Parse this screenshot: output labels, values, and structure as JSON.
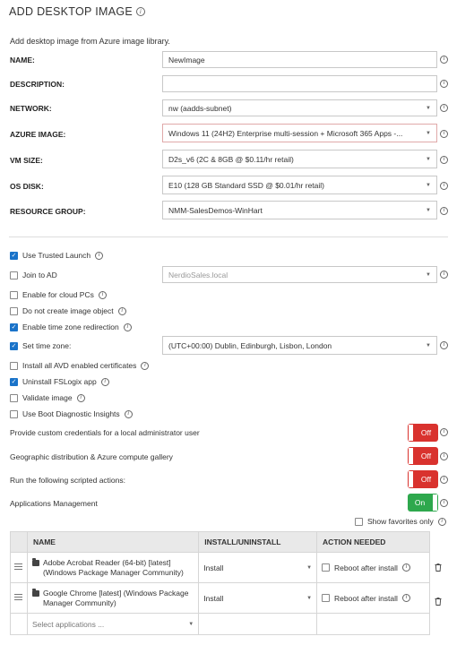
{
  "header": {
    "title": "ADD DESKTOP IMAGE",
    "subtitle": "Add desktop image from Azure image library."
  },
  "fields": [
    {
      "label": "NAME:",
      "value": "NewImage",
      "type": "text"
    },
    {
      "label": "DESCRIPTION:",
      "value": "",
      "type": "text"
    },
    {
      "label": "NETWORK:",
      "value": "nw (aadds-subnet)",
      "type": "select"
    },
    {
      "label": "AZURE IMAGE:",
      "value": "Windows 11 (24H2) Enterprise multi-session + Microsoft 365 Apps -...",
      "type": "select"
    },
    {
      "label": "VM SIZE:",
      "value": "D2s_v6 (2C & 8GB @ $0.11/hr retail)",
      "type": "select"
    },
    {
      "label": "OS DISK:",
      "value": "E10 (128 GB Standard SSD @ $0.01/hr retail)",
      "type": "select"
    },
    {
      "label": "RESOURCE GROUP:",
      "value": "NMM-SalesDemos-WinHart",
      "type": "select"
    }
  ],
  "options": [
    {
      "label": "Use Trusted Launch",
      "checked": true,
      "info": true
    },
    {
      "label": "Join to AD",
      "checked": false,
      "info": false
    },
    {
      "label": "Enable for cloud PCs",
      "checked": false,
      "info": true
    },
    {
      "label": "Do not create image object",
      "checked": false,
      "info": true
    },
    {
      "label": "Enable time zone redirection",
      "checked": true,
      "info": true
    },
    {
      "label": "Set time zone:",
      "checked": true,
      "info": false
    },
    {
      "label": "Install all AVD enabled certificates",
      "checked": false,
      "info": true
    },
    {
      "label": "Uninstall FSLogix app",
      "checked": true,
      "info": true
    },
    {
      "label": "Validate image",
      "checked": false,
      "info": true
    },
    {
      "label": "Use Boot Diagnostic Insights",
      "checked": false,
      "info": true
    }
  ],
  "join_ad_domain": "NerdioSales.local",
  "time_zone": "(UTC+00:00) Dublin, Edinburgh, Lisbon, London",
  "toggles": [
    {
      "label": "Provide custom credentials for a local administrator user",
      "state": "Off"
    },
    {
      "label": "Geographic distribution & Azure compute gallery",
      "state": "Off"
    },
    {
      "label": "Run the following scripted actions:",
      "state": "Off"
    },
    {
      "label": "Applications Management",
      "state": "On"
    }
  ],
  "show_favorites_only": "Show favorites only",
  "apps_table": {
    "headers": [
      "NAME",
      "INSTALL/UNINSTALL",
      "ACTION NEEDED"
    ],
    "rows": [
      {
        "name": "Adobe Acrobat Reader (64-bit) [latest] (Windows Package Manager Community)",
        "action": "Install",
        "needed": "Reboot after install"
      },
      {
        "name": "Google Chrome [latest] (Windows Package Manager Community)",
        "action": "Install",
        "needed": "Reboot after install"
      }
    ],
    "select_placeholder": "Select applications ..."
  },
  "colors": {
    "accent": "#1a73c9",
    "off": "#d9322e",
    "on": "#2ea84d"
  }
}
